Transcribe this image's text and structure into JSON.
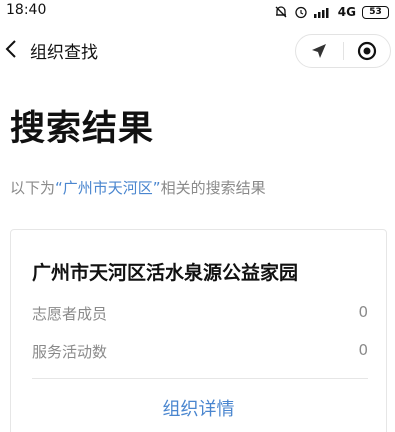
{
  "status_bar": {
    "time": "18:40",
    "network": "4G",
    "battery": "53",
    "icons": [
      "mute-bell-icon",
      "alarm-icon",
      "signal-icon",
      "battery-icon"
    ]
  },
  "nav": {
    "back_icon": "chevron-left-icon",
    "title": "组织查找",
    "capsule_icons": [
      "location-arrow-icon",
      "record-target-icon"
    ]
  },
  "page": {
    "title": "搜索结果",
    "desc_prefix": "以下为",
    "desc_keyword": "“广州市天河区”",
    "desc_suffix": "相关的搜索结果"
  },
  "results": [
    {
      "name": "广州市天河区活水泉源公益家园",
      "stats": [
        {
          "label": "志愿者成员",
          "value": "0"
        },
        {
          "label": "服务活动数",
          "value": "0"
        }
      ],
      "link_label": "组织详情"
    }
  ],
  "colors": {
    "accent": "#4a86cf",
    "muted_text": "#8a8a8a",
    "border": "#e6e6e6"
  }
}
